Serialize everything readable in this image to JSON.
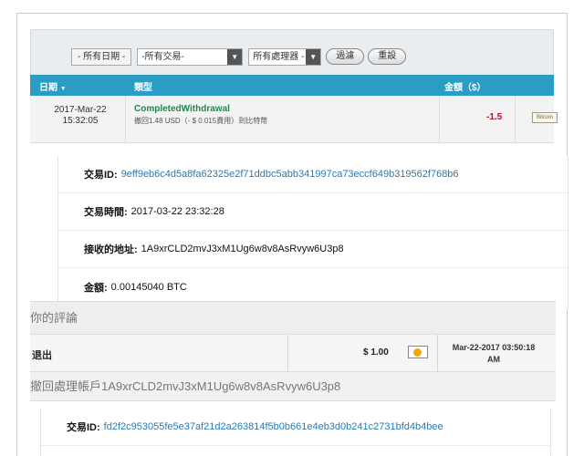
{
  "filters": {
    "date_label": "- 所有日期 -",
    "type_value": "-所有交易-",
    "processor_value": "所有處理器 -",
    "filter_button": "過濾",
    "reset_button": "重設"
  },
  "table": {
    "headers": {
      "date": "日期",
      "type": "類型",
      "amount": "金額（$）"
    },
    "row": {
      "date_line1": "2017-Mar-22",
      "date_line2": "15:32:05",
      "type_title": "CompletedWithdrawal",
      "type_desc": "撤回1.48 USD（- $ 0.015費用）到比特幣",
      "amount": "-1.5",
      "processor_badge": "Bitcoin"
    }
  },
  "details": {
    "tx_id_label": "交易ID:",
    "tx_id_value": "9eff9eb6c4d5a8fa62325e2f71ddbc5abb341997ca73eccf649b319562f768b6",
    "tx_time_label": "交易時間:",
    "tx_time_value": "2017-03-22 23:32:28",
    "address_label": "接收的地址:",
    "address_value": "1A9xrCLD2mvJ3xM1Ug6w8v8AsRvyw6U3p8",
    "amount_label": "金額:",
    "amount_value": "0.00145040 BTC"
  },
  "comments": {
    "heading": "你的評論",
    "out_label": "退出",
    "out_amount": "$ 1.00",
    "out_date_line1": "Mar-22-2017 03:50:18",
    "out_date_line2": "AM",
    "withdraw_heading": "撤回處理帳戶1A9xrCLD2mvJ3xM1Ug6w8v8AsRvyw6U3p8"
  },
  "details2": {
    "tx_id_label": "交易ID:",
    "tx_id_value": "fd2f2c953055fe5e37af21d2a263814f5b0b661e4eb3d0b241c2731bfd4b4bee"
  },
  "colors": {
    "header_blue": "#2b9cc4",
    "completed_green": "#1b8a4d",
    "negative_red": "#d0021b",
    "link_blue": "#2a7ab0",
    "bitcoin_orange": "#f2a900"
  }
}
